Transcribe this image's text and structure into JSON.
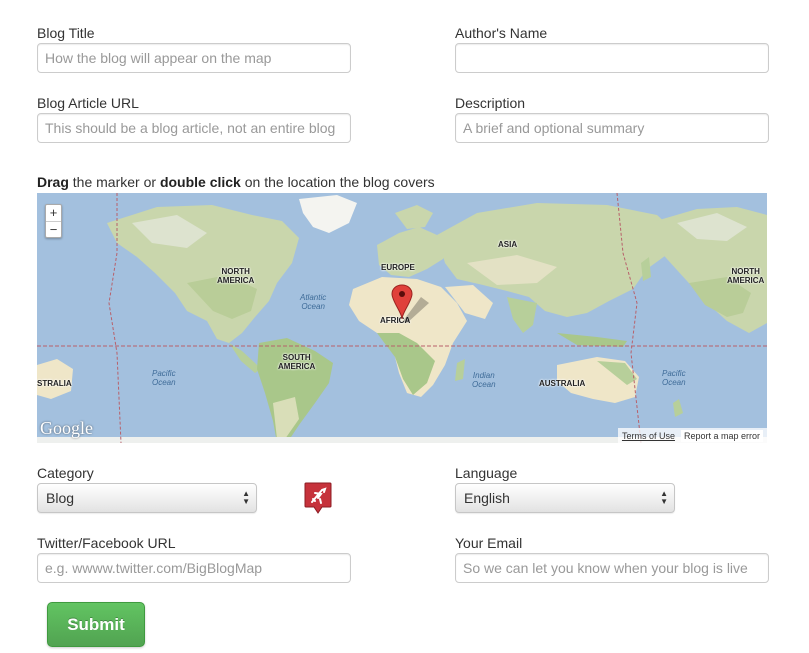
{
  "form": {
    "blog_title": {
      "label": "Blog Title",
      "placeholder": "How the blog will appear on the map"
    },
    "author_name": {
      "label": "Author's Name",
      "placeholder": ""
    },
    "article_url": {
      "label": "Blog Article URL",
      "placeholder": "This should be a blog article, not an entire blog"
    },
    "description": {
      "label": "Description",
      "placeholder": "A brief and optional summary"
    },
    "map_instruction": {
      "bold1": "Drag",
      "text1": " the marker or ",
      "bold2": "double click",
      "text2": " on the location the blog covers"
    },
    "category": {
      "label": "Category",
      "value": "Blog",
      "icon": "plane-marker-icon"
    },
    "language": {
      "label": "Language",
      "value": "English"
    },
    "social_url": {
      "label": "Twitter/Facebook URL",
      "placeholder": "e.g. wwww.twitter.com/BigBlogMap"
    },
    "email": {
      "label": "Your Email",
      "placeholder": "So we can let you know when your blog is live"
    },
    "submit_label": "Submit"
  },
  "map": {
    "zoom_in": "+",
    "zoom_out": "−",
    "logo": "Google",
    "terms": "Terms of Use",
    "report": "Report a map error",
    "labels": {
      "north_america_left": "NORTH\nAMERICA",
      "north_america_right": "NORTH\nAMERICA",
      "south_america": "SOUTH\nAMERICA",
      "europe": "EUROPE",
      "asia": "ASIA",
      "africa": "AFRICA",
      "australia_left": "STRALIA",
      "australia_right": "AUSTRALIA",
      "atlantic": "Atlantic\nOcean",
      "pacific_left": "Pacific\nOcean",
      "pacific_right": "Pacific\nOcean",
      "indian": "Indian\nOcean"
    },
    "colors": {
      "water": "#a3c0de",
      "land": "#d7dec0",
      "forest": "#b7cf9a",
      "desert": "#efe6c8",
      "marker": "#e0403a"
    }
  }
}
